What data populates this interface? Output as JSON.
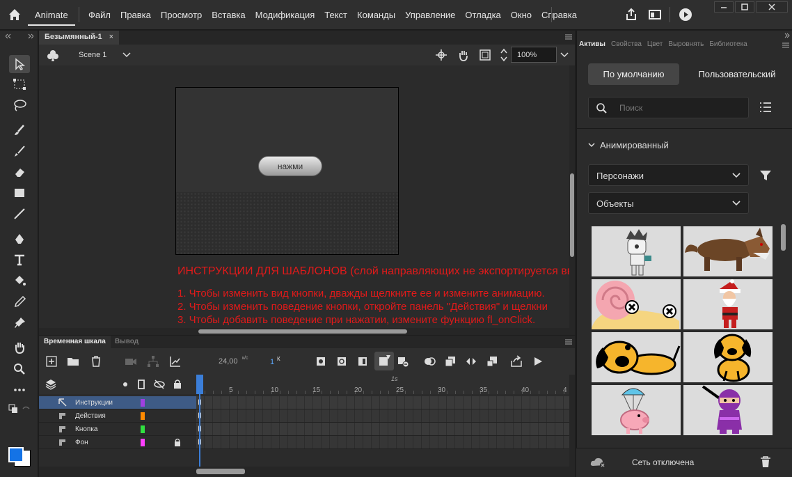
{
  "app": {
    "name": "Animate"
  },
  "menu": [
    "Файл",
    "Правка",
    "Просмотр",
    "Вставка",
    "Модификация",
    "Текст",
    "Команды",
    "Управление",
    "Отладка",
    "Окно",
    "Справка"
  ],
  "document": {
    "tab_title": "Безымянный-1",
    "tab_close": "×",
    "scene": "Scene 1",
    "zoom": "100%"
  },
  "stage": {
    "button_label": "нажми"
  },
  "instructions": {
    "title": "ИНСТРУКЦИИ ДЛЯ ШАБЛОНОВ (слой направляющих не экспортируется вв",
    "line1": "1. Чтобы изменить вид кнопки, дважды щелкните ее и измените анимацию.",
    "line2": "2. Чтобы изменить поведение кнопки, откройте панель \"Действия\" и щелкни",
    "line3": "3. Чтобы добавить поведение при нажатии, измените функцию fl_onClick."
  },
  "timeline": {
    "tab_timeline": "Временная шкала",
    "tab_output": "Вывод",
    "fps": "24,00",
    "fps_unit": "к/с",
    "frame": "1",
    "frame_unit": "К",
    "ruler_top_label": "1s",
    "ruler_ticks": [
      "5",
      "10",
      "15",
      "20",
      "25",
      "30",
      "35",
      "40",
      "4"
    ],
    "layers": [
      {
        "name": "Инструкции",
        "color": "#a040e0",
        "selected": true,
        "locked": false
      },
      {
        "name": "Действия",
        "color": "#ff8a00",
        "selected": false,
        "locked": false
      },
      {
        "name": "Кнопка",
        "color": "#30e040",
        "selected": false,
        "locked": false
      },
      {
        "name": "Фон",
        "color": "#ff40ff",
        "selected": false,
        "locked": true
      }
    ]
  },
  "panel": {
    "tabs": [
      "Активы",
      "Свойства",
      "Цвет",
      "Выровнять",
      "Библиотека"
    ],
    "active_tab": "Активы",
    "btn_default": "По умолчанию",
    "btn_custom": "Пользовательский",
    "search_placeholder": "Поиск",
    "section": "Анимированный",
    "dropdown1": "Персонажи",
    "dropdown2": "Объекты",
    "status": "Сеть отключена",
    "assets": [
      "mummy-asset",
      "wolf-asset",
      "snail-asset",
      "santa-asset",
      "dog-lying-asset",
      "dog-sitting-asset",
      "parachute-pig-asset",
      "ninja-asset"
    ]
  },
  "colors": {
    "accent_blue": "#1473e6",
    "instruction_red": "#e01a1a",
    "selected_layer": "#3e5b86"
  }
}
